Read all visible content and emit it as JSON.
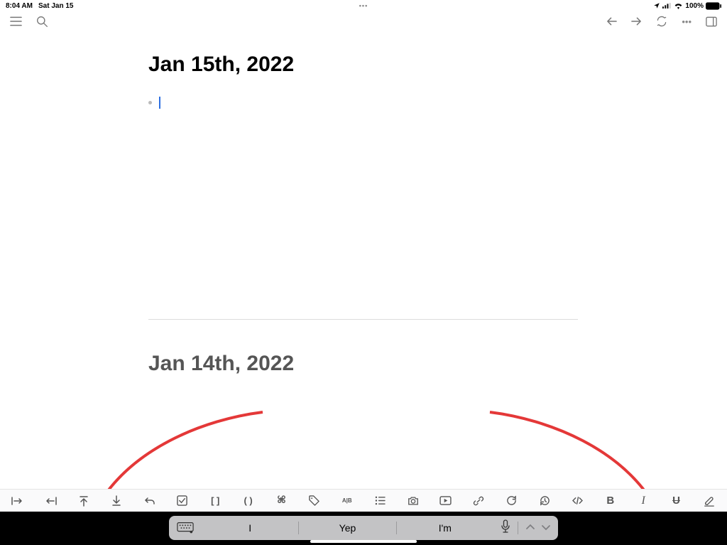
{
  "status": {
    "time": "8:04 AM",
    "date": "Sat Jan 15",
    "battery_pct": "100%"
  },
  "journal": {
    "today_heading": "Jan 15th, 2022",
    "prev_heading": "Jan 14th, 2022"
  },
  "suggestions": {
    "s1": "I",
    "s2": "Yep",
    "s3": "I'm"
  }
}
